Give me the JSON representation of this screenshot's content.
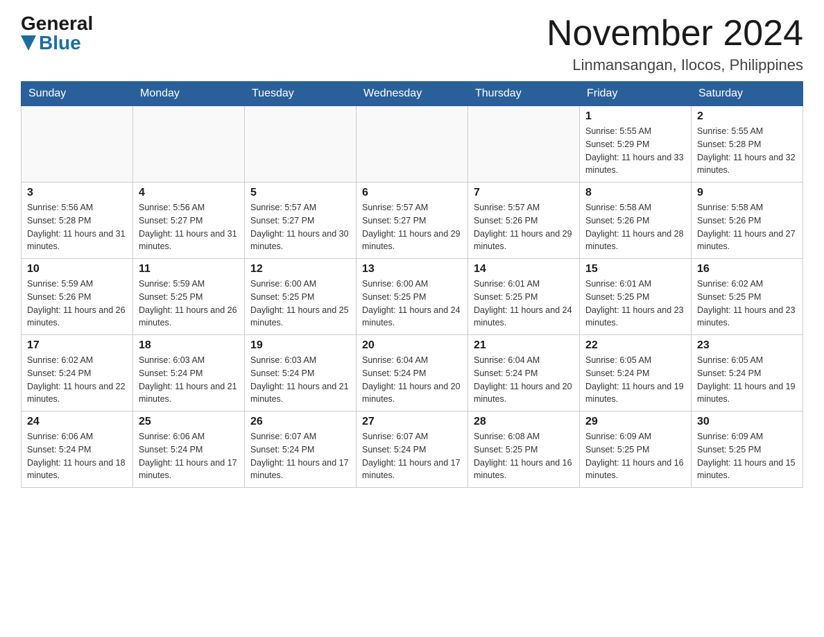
{
  "header": {
    "logo": {
      "general": "General",
      "blue": "Blue"
    },
    "title": "November 2024",
    "location": "Linmansangan, Ilocos, Philippines"
  },
  "weekdays": [
    "Sunday",
    "Monday",
    "Tuesday",
    "Wednesday",
    "Thursday",
    "Friday",
    "Saturday"
  ],
  "weeks": [
    [
      {
        "day": "",
        "info": ""
      },
      {
        "day": "",
        "info": ""
      },
      {
        "day": "",
        "info": ""
      },
      {
        "day": "",
        "info": ""
      },
      {
        "day": "",
        "info": ""
      },
      {
        "day": "1",
        "info": "Sunrise: 5:55 AM\nSunset: 5:29 PM\nDaylight: 11 hours and 33 minutes."
      },
      {
        "day": "2",
        "info": "Sunrise: 5:55 AM\nSunset: 5:28 PM\nDaylight: 11 hours and 32 minutes."
      }
    ],
    [
      {
        "day": "3",
        "info": "Sunrise: 5:56 AM\nSunset: 5:28 PM\nDaylight: 11 hours and 31 minutes."
      },
      {
        "day": "4",
        "info": "Sunrise: 5:56 AM\nSunset: 5:27 PM\nDaylight: 11 hours and 31 minutes."
      },
      {
        "day": "5",
        "info": "Sunrise: 5:57 AM\nSunset: 5:27 PM\nDaylight: 11 hours and 30 minutes."
      },
      {
        "day": "6",
        "info": "Sunrise: 5:57 AM\nSunset: 5:27 PM\nDaylight: 11 hours and 29 minutes."
      },
      {
        "day": "7",
        "info": "Sunrise: 5:57 AM\nSunset: 5:26 PM\nDaylight: 11 hours and 29 minutes."
      },
      {
        "day": "8",
        "info": "Sunrise: 5:58 AM\nSunset: 5:26 PM\nDaylight: 11 hours and 28 minutes."
      },
      {
        "day": "9",
        "info": "Sunrise: 5:58 AM\nSunset: 5:26 PM\nDaylight: 11 hours and 27 minutes."
      }
    ],
    [
      {
        "day": "10",
        "info": "Sunrise: 5:59 AM\nSunset: 5:26 PM\nDaylight: 11 hours and 26 minutes."
      },
      {
        "day": "11",
        "info": "Sunrise: 5:59 AM\nSunset: 5:25 PM\nDaylight: 11 hours and 26 minutes."
      },
      {
        "day": "12",
        "info": "Sunrise: 6:00 AM\nSunset: 5:25 PM\nDaylight: 11 hours and 25 minutes."
      },
      {
        "day": "13",
        "info": "Sunrise: 6:00 AM\nSunset: 5:25 PM\nDaylight: 11 hours and 24 minutes."
      },
      {
        "day": "14",
        "info": "Sunrise: 6:01 AM\nSunset: 5:25 PM\nDaylight: 11 hours and 24 minutes."
      },
      {
        "day": "15",
        "info": "Sunrise: 6:01 AM\nSunset: 5:25 PM\nDaylight: 11 hours and 23 minutes."
      },
      {
        "day": "16",
        "info": "Sunrise: 6:02 AM\nSunset: 5:25 PM\nDaylight: 11 hours and 23 minutes."
      }
    ],
    [
      {
        "day": "17",
        "info": "Sunrise: 6:02 AM\nSunset: 5:24 PM\nDaylight: 11 hours and 22 minutes."
      },
      {
        "day": "18",
        "info": "Sunrise: 6:03 AM\nSunset: 5:24 PM\nDaylight: 11 hours and 21 minutes."
      },
      {
        "day": "19",
        "info": "Sunrise: 6:03 AM\nSunset: 5:24 PM\nDaylight: 11 hours and 21 minutes."
      },
      {
        "day": "20",
        "info": "Sunrise: 6:04 AM\nSunset: 5:24 PM\nDaylight: 11 hours and 20 minutes."
      },
      {
        "day": "21",
        "info": "Sunrise: 6:04 AM\nSunset: 5:24 PM\nDaylight: 11 hours and 20 minutes."
      },
      {
        "day": "22",
        "info": "Sunrise: 6:05 AM\nSunset: 5:24 PM\nDaylight: 11 hours and 19 minutes."
      },
      {
        "day": "23",
        "info": "Sunrise: 6:05 AM\nSunset: 5:24 PM\nDaylight: 11 hours and 19 minutes."
      }
    ],
    [
      {
        "day": "24",
        "info": "Sunrise: 6:06 AM\nSunset: 5:24 PM\nDaylight: 11 hours and 18 minutes."
      },
      {
        "day": "25",
        "info": "Sunrise: 6:06 AM\nSunset: 5:24 PM\nDaylight: 11 hours and 17 minutes."
      },
      {
        "day": "26",
        "info": "Sunrise: 6:07 AM\nSunset: 5:24 PM\nDaylight: 11 hours and 17 minutes."
      },
      {
        "day": "27",
        "info": "Sunrise: 6:07 AM\nSunset: 5:24 PM\nDaylight: 11 hours and 17 minutes."
      },
      {
        "day": "28",
        "info": "Sunrise: 6:08 AM\nSunset: 5:25 PM\nDaylight: 11 hours and 16 minutes."
      },
      {
        "day": "29",
        "info": "Sunrise: 6:09 AM\nSunset: 5:25 PM\nDaylight: 11 hours and 16 minutes."
      },
      {
        "day": "30",
        "info": "Sunrise: 6:09 AM\nSunset: 5:25 PM\nDaylight: 11 hours and 15 minutes."
      }
    ]
  ]
}
